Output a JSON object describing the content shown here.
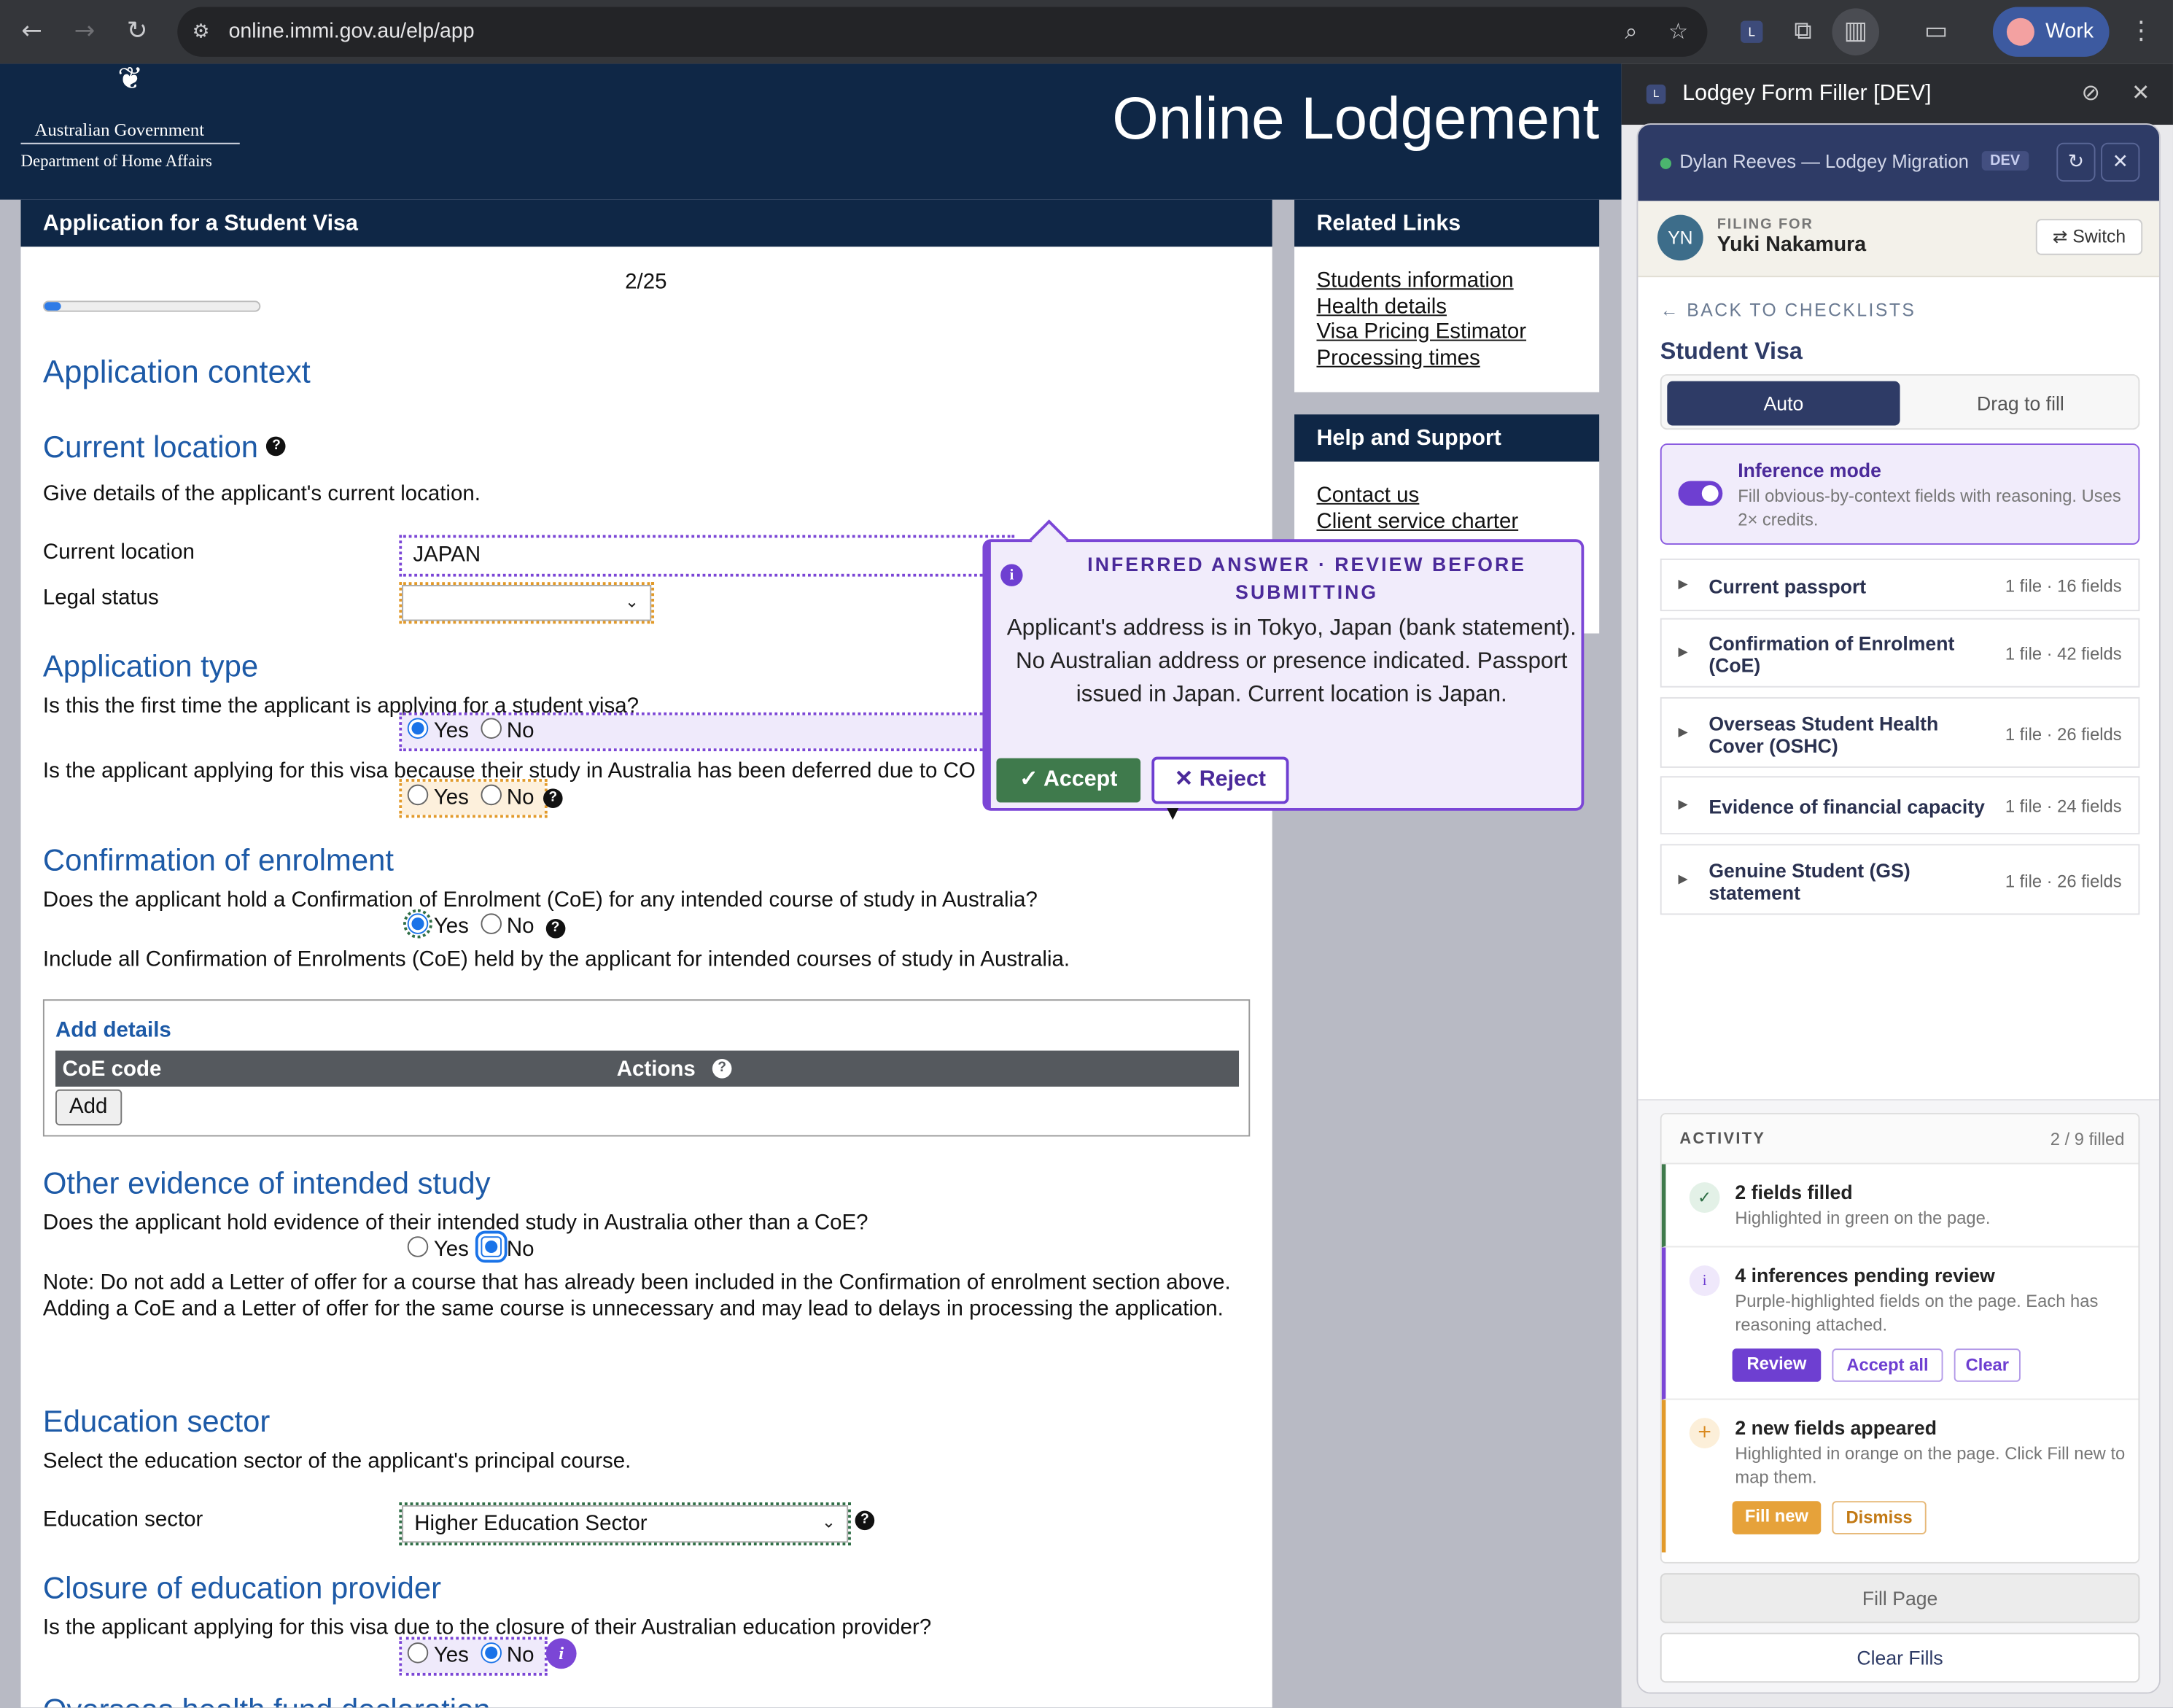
{
  "browser": {
    "url": "online.immi.gov.au/elp/app",
    "profile_label": "Work"
  },
  "gov": {
    "logo_line1": "Australian Government",
    "logo_line2": "Department of Home Affairs",
    "title": "Online Lodgement"
  },
  "form": {
    "header": "Application for a Student Visa",
    "page_indicator": "2/25",
    "progress": 0.08,
    "section_application_context": "Application context",
    "current_location": {
      "heading": "Current location",
      "description": "Give details of the applicant's current location.",
      "location_label": "Current location",
      "location_value": "JAPAN",
      "legal_status_label": "Legal status",
      "legal_status_value": ""
    },
    "application_type": {
      "heading": "Application type",
      "q1": "Is this the first time the applicant is applying for a student visa?",
      "q2": "Is the applicant applying for this visa because their study in Australia has been deferred due to CO"
    },
    "coe": {
      "heading": "Confirmation of enrolment",
      "question": "Does the applicant hold a Confirmation of Enrolment (CoE) for any intended course of study in Australia?",
      "note": "Include all Confirmation of Enrolments (CoE) held by the applicant for intended courses of study in Australia.",
      "add_details": "Add details",
      "col_code": "CoE code",
      "col_actions": "Actions",
      "add_button": "Add"
    },
    "other_evidence": {
      "heading": "Other evidence of intended study",
      "question": "Does the applicant hold evidence of their intended study in Australia other than a CoE?",
      "note": "Note: Do not add a Letter of offer for a course that has already been included in the Confirmation of enrolment section above. Adding a CoE and a Letter of offer for the same course is unnecessary and may lead to delays in processing the application."
    },
    "education_sector": {
      "heading": "Education sector",
      "description": "Select the education sector of the applicant's principal course.",
      "label": "Education sector",
      "value": "Higher Education Sector"
    },
    "closure": {
      "heading": "Closure of education provider",
      "question": "Is the applicant applying for this visa due to the closure of their Australian education provider?",
      "next_heading_partial": "Overseas health fund declaration"
    },
    "yes": "Yes",
    "no": "No"
  },
  "related_links": {
    "title": "Related Links",
    "links": [
      "Students information",
      "Health details",
      "Visa Pricing Estimator",
      "Processing times"
    ]
  },
  "help_support": {
    "title": "Help and Support",
    "links": [
      "Contact us",
      "Client service charter"
    ]
  },
  "popover": {
    "title": "INFERRED ANSWER · REVIEW BEFORE SUBMITTING",
    "body": "Applicant's address is in Tokyo, Japan (bank statement). No Australian address or presence indicated. Passport issued in Japan. Current location is Japan.",
    "accept": "✓ Accept",
    "reject": "✕ Reject"
  },
  "extension": {
    "title": "Lodgey Form Filler [DEV]",
    "workspace": "Dylan Reeves — Lodgey Migration",
    "env_badge": "DEV",
    "filing_for_label": "FILING FOR",
    "client_initials": "YN",
    "client_name": "Yuki Nakamura",
    "switch": "⇄ Switch",
    "back": "← BACK TO CHECKLISTS",
    "visa_title": "Student Visa",
    "tab_auto": "Auto",
    "tab_drag": "Drag to fill",
    "inference_title": "Inference mode",
    "inference_desc": "Fill obvious-by-context fields with reasoning. Uses 2× credits.",
    "checklists": [
      {
        "name": "Current passport",
        "meta": "1 file · 16 fields"
      },
      {
        "name": "Confirmation of Enrolment (CoE)",
        "meta": "1 file · 42 fields"
      },
      {
        "name": "Overseas Student Health Cover (OSHC)",
        "meta": "1 file · 26 fields"
      },
      {
        "name": "Evidence of financial capacity",
        "meta": "1 file · 24 fields"
      },
      {
        "name": "Genuine Student (GS) statement",
        "meta": "1 file · 26 fields"
      }
    ],
    "activity": {
      "label": "ACTIVITY",
      "count": "2 / 9 filled",
      "items": [
        {
          "title": "2 fields filled",
          "desc": "Highlighted in green on the page."
        },
        {
          "title": "4 inferences pending review",
          "desc": "Purple-highlighted fields on the page. Each has reasoning attached.",
          "btn1": "Review",
          "btn2": "Accept all",
          "btn3": "Clear"
        },
        {
          "title": "2 new fields appeared",
          "desc": "Highlighted in orange on the page. Click Fill new to map them.",
          "btn1": "Fill new",
          "btn2": "Dismiss"
        }
      ]
    },
    "fill_page": "Fill Page",
    "clear_fills": "Clear Fills"
  },
  "colors": {
    "gov_navy": "#0f2746",
    "form_heading_blue": "#1d5aa7",
    "inference_purple": "#7b46d6",
    "filled_green": "#2f6e46",
    "new_orange": "#e29a2a"
  }
}
